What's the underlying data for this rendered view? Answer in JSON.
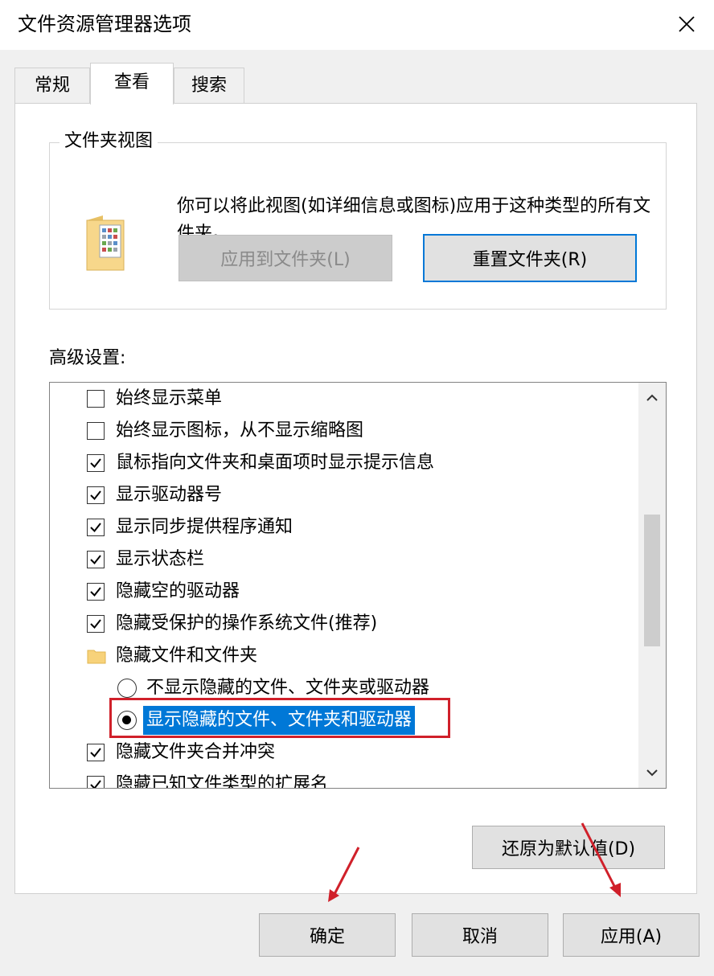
{
  "window": {
    "title": "文件资源管理器选项"
  },
  "tabs": [
    {
      "label": "常规",
      "active": false
    },
    {
      "label": "查看",
      "active": true
    },
    {
      "label": "搜索",
      "active": false
    }
  ],
  "folder_views": {
    "legend": "文件夹视图",
    "description": "你可以将此视图(如详细信息或图标)应用于这种类型的所有文件夹。",
    "apply_button": "应用到文件夹(L)",
    "reset_button": "重置文件夹(R)"
  },
  "advanced": {
    "label": "高级设置:",
    "items": [
      {
        "type": "checkbox",
        "checked": false,
        "label": "始终显示菜单"
      },
      {
        "type": "checkbox",
        "checked": false,
        "label": "始终显示图标，从不显示缩略图"
      },
      {
        "type": "checkbox",
        "checked": true,
        "label": "鼠标指向文件夹和桌面项时显示提示信息"
      },
      {
        "type": "checkbox",
        "checked": true,
        "label": "显示驱动器号"
      },
      {
        "type": "checkbox",
        "checked": true,
        "label": "显示同步提供程序通知"
      },
      {
        "type": "checkbox",
        "checked": true,
        "label": "显示状态栏"
      },
      {
        "type": "checkbox",
        "checked": true,
        "label": "隐藏空的驱动器"
      },
      {
        "type": "checkbox",
        "checked": true,
        "label": "隐藏受保护的操作系统文件(推荐)"
      },
      {
        "type": "folder",
        "label": "隐藏文件和文件夹"
      },
      {
        "type": "radio",
        "checked": false,
        "label": "不显示隐藏的文件、文件夹或驱动器"
      },
      {
        "type": "radio",
        "checked": true,
        "selected": true,
        "label": "显示隐藏的文件、文件夹和驱动器"
      },
      {
        "type": "checkbox",
        "checked": true,
        "label": "隐藏文件夹合并冲突"
      },
      {
        "type": "checkbox",
        "checked": true,
        "label": "隐藏已知文件类型的扩展名"
      }
    ],
    "restore_button": "还原为默认值(D)"
  },
  "footer": {
    "ok": "确定",
    "cancel": "取消",
    "apply": "应用(A)"
  },
  "colors": {
    "selection": "#0078d7",
    "highlight_box": "#d0202a",
    "annotation_arrow": "#d0202a"
  }
}
